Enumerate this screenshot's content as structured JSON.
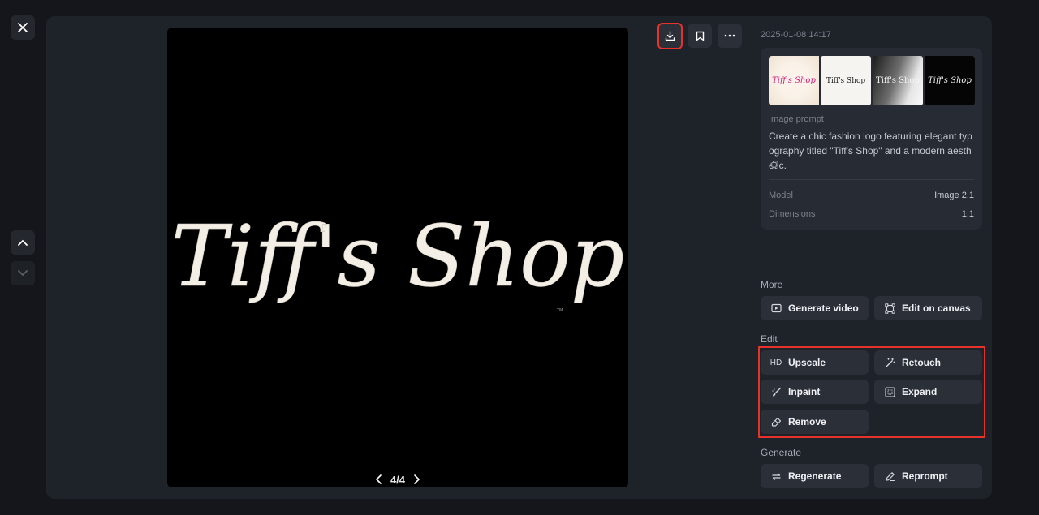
{
  "viewer": {
    "pager": {
      "current_total": "4/4"
    },
    "canvas_text": "Tiff's Shop",
    "canvas_tiny": "TM"
  },
  "info": {
    "timestamp": "2025-01-08 14:17",
    "thumbnails": [
      "Tiff's Shop",
      "Tiff's Shop",
      "Tiff's Shop",
      "Tiff's Shop"
    ],
    "prompt_label": "Image prompt",
    "prompt_text": "Create a chic fashion logo featuring elegant typography titled \"Tiff's Shop\" and a modern aesthetic.",
    "model_label": "Model",
    "model_value": "Image 2.1",
    "dimensions_label": "Dimensions",
    "dimensions_value": "1:1"
  },
  "sections": {
    "more": "More",
    "edit": "Edit",
    "generate": "Generate"
  },
  "buttons": {
    "generate_video": "Generate video",
    "edit_on_canvas": "Edit on canvas",
    "upscale_prefix": "HD",
    "upscale": "Upscale",
    "retouch": "Retouch",
    "inpaint": "Inpaint",
    "expand": "Expand",
    "remove": "Remove",
    "regenerate": "Regenerate",
    "reprompt": "Reprompt"
  },
  "icons": {
    "close": "close-icon",
    "up": "chevron-up-icon",
    "down": "chevron-down-icon",
    "download": "download-icon",
    "bookmark": "bookmark-icon",
    "more": "more-icon"
  },
  "colors": {
    "highlight": "#e5322d",
    "panel": "#1e2229",
    "button": "#2b2f37"
  }
}
